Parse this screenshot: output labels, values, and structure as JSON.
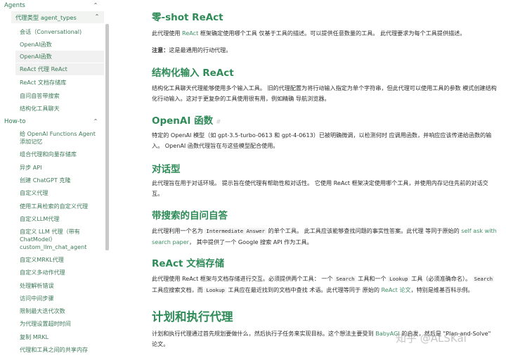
{
  "sidebar": {
    "section_agents": "Agents",
    "subsection_agent_types": "代理类型 agent_types",
    "agent_types": [
      "会话（Conversational)",
      "OpenAI函数",
      "OpenAI函数",
      "ReAct 代理 ReAct",
      "ReAct 文档存储库",
      "自问自答带搜索",
      "结构化工具聊天"
    ],
    "section_howto": "How-to",
    "howto_items": [
      [
        "给 OpenAI Functions Agent",
        "添加记忆"
      ],
      [
        "组合代理和向量存储库"
      ],
      [
        "异步 API"
      ],
      [
        "创建 ChatGPT 克隆"
      ],
      [
        "自定义代理"
      ],
      [
        "使用工具检索的自定义代理"
      ],
      [
        "自定义LLM代理"
      ],
      [
        "自定义 LLM 代理（带有",
        "ChatModel）",
        "custom_llm_chat_agent"
      ],
      [
        "自定义MRKL代理"
      ],
      [
        "自定义多动作代理"
      ],
      [
        "处理解析错误"
      ],
      [
        "访问中间步骤"
      ],
      [
        "限制最大迭代次数"
      ],
      [
        "为代理设置超时时间"
      ],
      [
        "复制 MRKL"
      ],
      [
        "代理和工具之间的共享内存"
      ]
    ]
  },
  "main": {
    "zero_shot": {
      "title": "零-shot ReAct",
      "p1_a": "此代理使用 ",
      "p1_link": "ReAct",
      "p1_b": " 框架确定使用哪个工具 仅基于工具的描述。可以提供任意数量的工具。 此代理要求为每个工具提供描述。",
      "note_label": "注意：",
      "note_text": "这是最通用的行动代理。"
    },
    "structured": {
      "title": "结构化输入 ReAct",
      "text": "结构化工具聊天代理能够使用多个输入工具。 旧的代理配置为将行动输入指定为单个字符串，但此代理可以使用工具的参数 模式创建结构化行动输入。这对于更复杂的工具使用很有用，例如精确 导航浏览器。"
    },
    "openai_fn": {
      "title": "OpenAI 函数",
      "hash": "#",
      "text": "特定的 OpenAI 模型（如 gpt-3.5-turbo-0613 和 gpt-4-0613）已被明确微调，以检测何时 应调用函数，并响应应该传递给函数的输入。 OpenAI 函数代理旨在与这些模型配合使用。"
    },
    "conversational": {
      "title": "对话型",
      "text": "此代理旨在用于对话环境。 提示旨在使代理有帮助性和对话性。 它使用 ReAct 框架决定使用哪个工具，并使用内存记住先前的对话交互。"
    },
    "self_ask": {
      "title": "带搜索的自问自答",
      "a": "此代理利用一个名为 ",
      "code": "Intermediate Answer",
      "b": " 的单个工具。 此工具应该能够查找问题的事实性答案。此代理 等同于原始的 ",
      "link": "self ask with search paper",
      "c": "， 其中提供了一个 Google 搜索 API 作为工具。"
    },
    "docstore": {
      "title": "ReAct 文档存储",
      "a": "此代理使用 ReAct 框架与文档存储进行交互。必须提供两个工具： 一个 ",
      "code1": "Search",
      "b": " 工具和一个 ",
      "code2": "Lookup",
      "c": " 工具（必须准确命名）。 ",
      "code3": "Search",
      "d": " 工具应搜索文档，而 ",
      "code4": "Lookup",
      "e": " 工具应在最近找到的文档中查找 术语。此代理等同于 原始的 ",
      "link": "ReAct 论文",
      "f": "，特别是维基百科示例。"
    },
    "plan_execute": {
      "title": "计划和执行代理",
      "a": "计划和执行代理通过首先规划要做什么，然后执行子任务来实现目标。这个想法主要受到 ",
      "link": "BabyAGI",
      "b": " 的启发，然后是 \"Plan-and-Solve\" 论文。"
    },
    "watermark": "知乎 @ALSKai"
  }
}
